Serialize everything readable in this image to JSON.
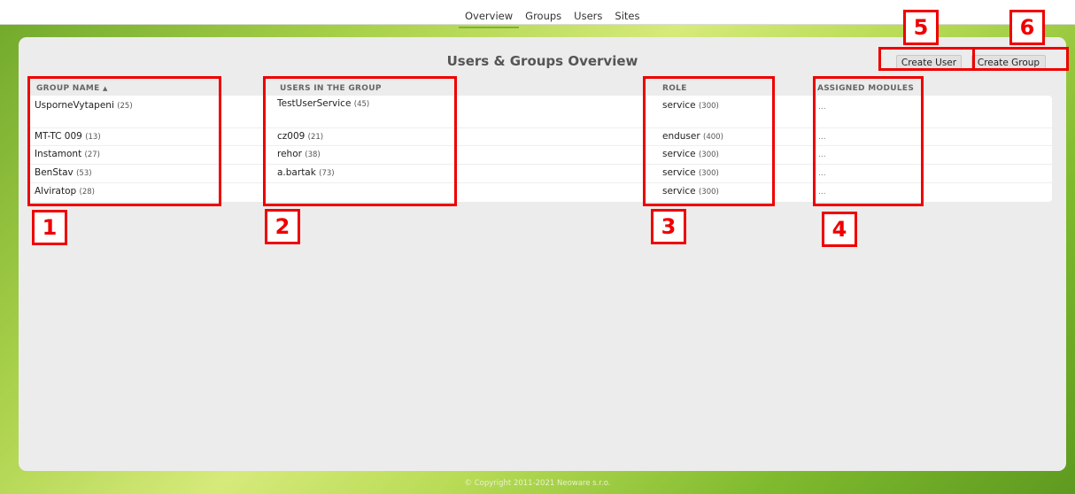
{
  "nav": {
    "tabs": [
      "Overview",
      "Groups",
      "Users",
      "Sites"
    ],
    "active": "Overview"
  },
  "page_title": "Users & Groups Overview",
  "buttons": {
    "create_user": "Create User",
    "create_group": "Create Group"
  },
  "columns": {
    "group_name": "Group name",
    "sort_indicator": "▲",
    "users_in_group": "Users in the group",
    "role": "Role",
    "assigned_modules": "Assigned modules"
  },
  "rows": [
    {
      "group": "UsporneVytapeni",
      "group_count": "(25)",
      "user": "TestUserService",
      "user_count": "(45)",
      "role": "service",
      "role_code": "(300)",
      "modules": "..."
    },
    {
      "group": "MT-TC 009",
      "group_count": "(13)",
      "user": "cz009",
      "user_count": "(21)",
      "role": "enduser",
      "role_code": "(400)",
      "modules": "..."
    },
    {
      "group": "Instamont",
      "group_count": "(27)",
      "user": "rehor",
      "user_count": "(38)",
      "role": "service",
      "role_code": "(300)",
      "modules": "..."
    },
    {
      "group": "BenStav",
      "group_count": "(53)",
      "user": "a.bartak",
      "user_count": "(73)",
      "role": "service",
      "role_code": "(300)",
      "modules": "..."
    },
    {
      "group": "Alviratop",
      "group_count": "(28)",
      "user": "",
      "user_count": "",
      "role": "service",
      "role_code": "(300)",
      "modules": "..."
    }
  ],
  "annotations": [
    "1",
    "2",
    "3",
    "4",
    "5",
    "6"
  ],
  "footer": "© Copyright 2011-2021 Neoware s.r.o.",
  "colors": {
    "marker": "#ee0000",
    "active_tab": "#7db52e",
    "panel": "#ececec"
  }
}
